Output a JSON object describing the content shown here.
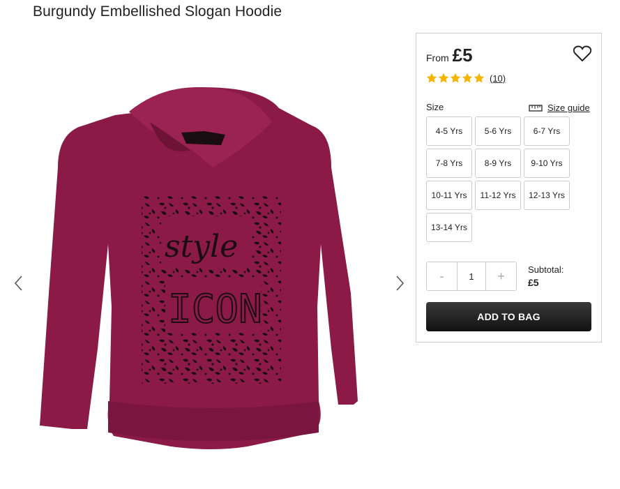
{
  "product": {
    "title": "Burgundy Embellished Slogan Hoodie",
    "garment_color": "#8b1a47"
  },
  "gallery": {
    "prev_icon": "chevron-left-icon",
    "next_icon": "chevron-right-icon",
    "print_text_script": "style",
    "print_text_block": "ICON"
  },
  "pricing": {
    "from_label": "From",
    "price": "£5"
  },
  "rating": {
    "stars": 5,
    "max_stars": 5,
    "star_color": "#f5b400",
    "count": "(10)"
  },
  "size": {
    "label": "Size",
    "guide_label": "Size guide",
    "options": [
      "4-5 Yrs",
      "5-6 Yrs",
      "6-7 Yrs",
      "7-8 Yrs",
      "8-9 Yrs",
      "9-10 Yrs",
      "10-11 Yrs",
      "11-12 Yrs",
      "12-13 Yrs",
      "13-14 Yrs"
    ]
  },
  "quantity": {
    "minus": "-",
    "value": "1",
    "plus": "+"
  },
  "subtotal": {
    "label": "Subtotal:",
    "value": "£5"
  },
  "cta": {
    "add_to_bag": "ADD TO BAG",
    "color": "#222222"
  }
}
